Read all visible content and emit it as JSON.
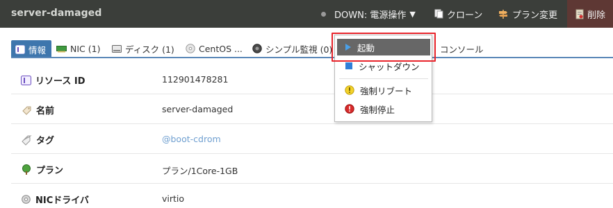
{
  "header": {
    "title": "server-damaged",
    "status_label": "DOWN: 電源操作",
    "clone_label": "クローン",
    "plan_change_label": "プラン変更",
    "delete_label": "削除"
  },
  "tabs": [
    {
      "label": "情報",
      "active": true
    },
    {
      "label": "NIC (1)"
    },
    {
      "label": "ディスク (1)"
    },
    {
      "label": "CentOS ..."
    },
    {
      "label": "シンプル監視 (0)"
    },
    {
      "label": "コンソール"
    }
  ],
  "info_rows": [
    {
      "label": "リソース ID",
      "value": "112901478281"
    },
    {
      "label": "名前",
      "value": "server-damaged"
    },
    {
      "label": "タグ",
      "value": "@boot-cdrom"
    },
    {
      "label": "プラン",
      "value": "プラン/1Core-1GB"
    },
    {
      "label": "NICドライバ",
      "value": "virtio"
    }
  ],
  "power_menu": {
    "items": [
      {
        "label": "起動",
        "icon": "play-icon",
        "highlighted": true
      },
      {
        "label": "シャットダウン",
        "icon": "stop-square-icon"
      },
      {
        "label": "強制リブート",
        "icon": "warning-icon"
      },
      {
        "label": "強制停止",
        "icon": "error-icon"
      }
    ]
  },
  "colors": {
    "header_bg": "#3b3e3a",
    "active_tab": "#3e76ad",
    "delete_bg": "#5e3834",
    "highlight_border": "#e8232a",
    "tag_link": "#6f9fd0"
  }
}
